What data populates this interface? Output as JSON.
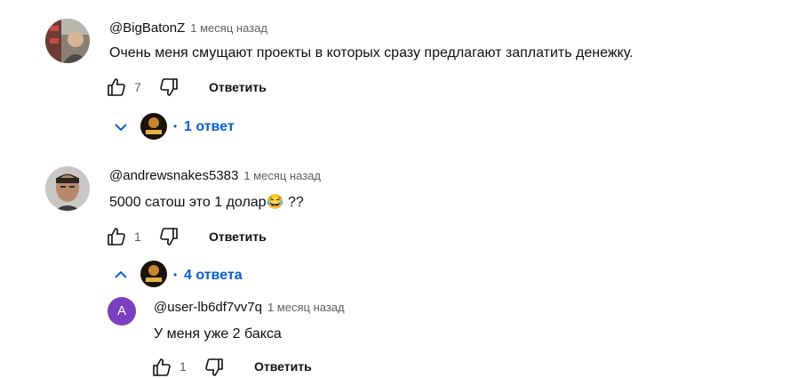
{
  "colors": {
    "link": "#065fd4",
    "muted": "#606060",
    "text": "#0f0f0f",
    "letter_avatar": "#7b3fbf"
  },
  "comments": [
    {
      "author": "@BigBatonZ",
      "time": "1 месяц назад",
      "text": "Очень меня смущают проекты в которых сразу предлагают заплатить денежку.",
      "likes": "7",
      "reply_label": "Ответить",
      "replies_toggle": "chevron-down-icon",
      "replies_label": "1 ответ"
    },
    {
      "author": "@andrewsnakes5383",
      "time": "1 месяц назад",
      "text": "5000 сатош это 1 долар",
      "text_suffix": " ??",
      "emoji": "😂",
      "likes": "1",
      "reply_label": "Ответить",
      "replies_toggle": "chevron-up-icon",
      "replies_label": "4 ответа"
    }
  ],
  "reply": {
    "avatar_letter": "A",
    "author": "@user-lb6df7vv7q",
    "time": "1 месяц назад",
    "text": "У меня уже 2 бакса",
    "likes": "1",
    "reply_label": "Ответить"
  },
  "separator": "•"
}
